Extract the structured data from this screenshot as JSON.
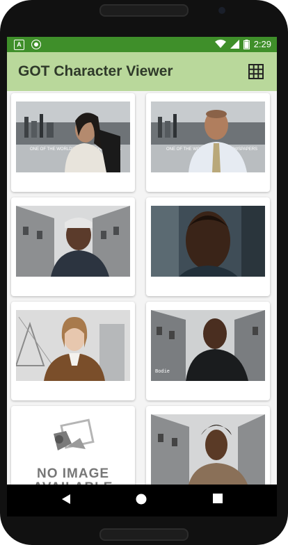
{
  "status_bar": {
    "time": "2:29",
    "left_icons": [
      "app-notification-icon",
      "sync-icon"
    ],
    "right_icons": [
      "wifi-icon",
      "signal-icon",
      "battery-icon"
    ],
    "notification_letter": "A"
  },
  "app_bar": {
    "title": "GOT Character Viewer",
    "action_icon": "grid-view-icon"
  },
  "cards": [
    {
      "id": 1,
      "caption_text": "ONE OF THE WORLD'S GREAT NEWSPAPERS",
      "type": "photo"
    },
    {
      "id": 2,
      "caption_text": "ONE OF THE WORLD'S GREAT NEWSPAPERS",
      "type": "photo"
    },
    {
      "id": 3,
      "type": "photo"
    },
    {
      "id": 4,
      "type": "photo"
    },
    {
      "id": 5,
      "type": "photo"
    },
    {
      "id": 6,
      "type": "photo",
      "name_tag": "Bodie"
    },
    {
      "id": 7,
      "type": "placeholder",
      "placeholder_text": "NO IMAGE AVAILABLE"
    },
    {
      "id": 8,
      "type": "photo"
    }
  ],
  "nav_bar": {
    "icons": [
      "back-icon",
      "home-icon",
      "recents-icon"
    ]
  },
  "colors": {
    "status_bar": "#3f8f2a",
    "app_bar": "#b9d89b",
    "title_text": "#2f3a2a"
  }
}
